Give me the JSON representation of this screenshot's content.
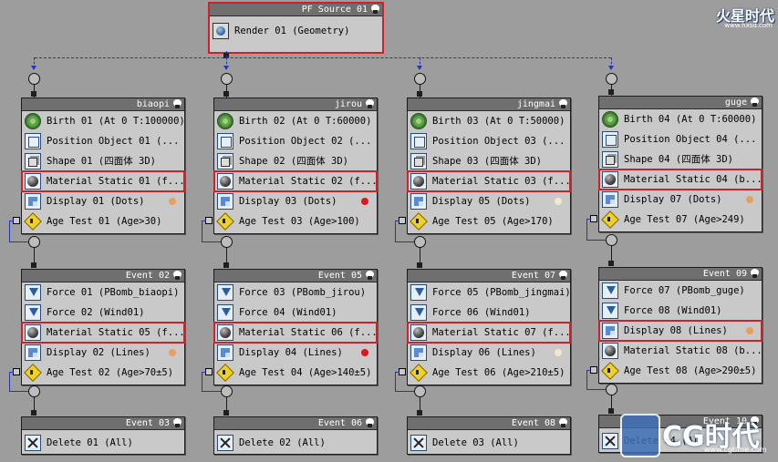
{
  "watermark_top": {
    "title": "火星时代",
    "url": "www.hxsd.com"
  },
  "watermark_bottom": {
    "brand": "CG时代",
    "url": "www.cgtime.com"
  },
  "source": {
    "title": "PF Source 01",
    "row": "Render 01 (Geometry)"
  },
  "top_events": [
    {
      "title": "biaopi",
      "rows": [
        "Birth 01 (At 0 T:100000)",
        "Position Object 01 (...",
        "Shape 01 (四面体 3D)",
        "Material Static 01 (f...",
        "Display 01 (Dots)",
        "Age Test 01 (Age>30)"
      ],
      "dot": "#e8a060"
    },
    {
      "title": "jirou",
      "rows": [
        "Birth 02 (At 0 T:60000)",
        "Position Object 02 (...",
        "Shape 02 (四面体 3D)",
        "Material Static 02 (f...",
        "Display 03 (Dots)",
        "Age Test 03 (Age>100)"
      ],
      "dot": "#e0141c"
    },
    {
      "title": "jingmai",
      "rows": [
        "Birth 03 (At 0 T:50000)",
        "Position Object 03 (...",
        "Shape 03 (四面体 3D)",
        "Material Static 03 (f...",
        "Display 05 (Dots)",
        "Age Test 05 (Age>170)"
      ],
      "dot": "#f3e7cc"
    },
    {
      "title": "guge",
      "rows": [
        "Birth 04 (At 0 T:60000)",
        "Position Object 04 (...",
        "Shape 04 (四面体 3D)",
        "Material Static 04 (b...",
        "Display 07 (Dots)",
        "Age Test 07 (Age>249)"
      ],
      "dot": "#e8a060"
    }
  ],
  "mid_events": [
    {
      "title": "Event 02",
      "rows": [
        "Force 01 (PBomb_biaopi)",
        "Force 02 (Wind01)",
        "Material Static 05 (f...",
        "Display 02 (Lines)",
        "Age Test 02 (Age>70±5)"
      ],
      "dot": "#e8a060"
    },
    {
      "title": "Event 05",
      "rows": [
        "Force 03 (PBomb_jirou)",
        "Force 04 (Wind01)",
        "Material Static 06 (f...",
        "Display 04 (Lines)",
        "Age Test 04 (Age>140±5)"
      ],
      "dot": "#e0141c"
    },
    {
      "title": "Event 07",
      "rows": [
        "Force 05 (PBomb_jingmai)",
        "Force 06 (Wind01)",
        "Material Static 07 (f...",
        "Display 06 (Lines)",
        "Age Test 06 (Age>210±5)"
      ],
      "dot": "#f3e7cc"
    },
    {
      "title": "Event 09",
      "rows": [
        "Force 07 (PBomb_guge)",
        "Force 08 (Wind01)",
        "Display 08 (Lines)",
        "Material Static 08 (b...",
        "Age Test 08 (Age>290±5)"
      ],
      "dot": "#e8a060"
    }
  ],
  "bottom_events": [
    {
      "title": "Event 03",
      "row": "Delete 01 (All)"
    },
    {
      "title": "Event 06",
      "row": "Delete 02 (All)"
    },
    {
      "title": "Event 08",
      "row": "Delete 03 (All)"
    },
    {
      "title": "Event 10",
      "row": "Delete 04 (All)"
    }
  ]
}
